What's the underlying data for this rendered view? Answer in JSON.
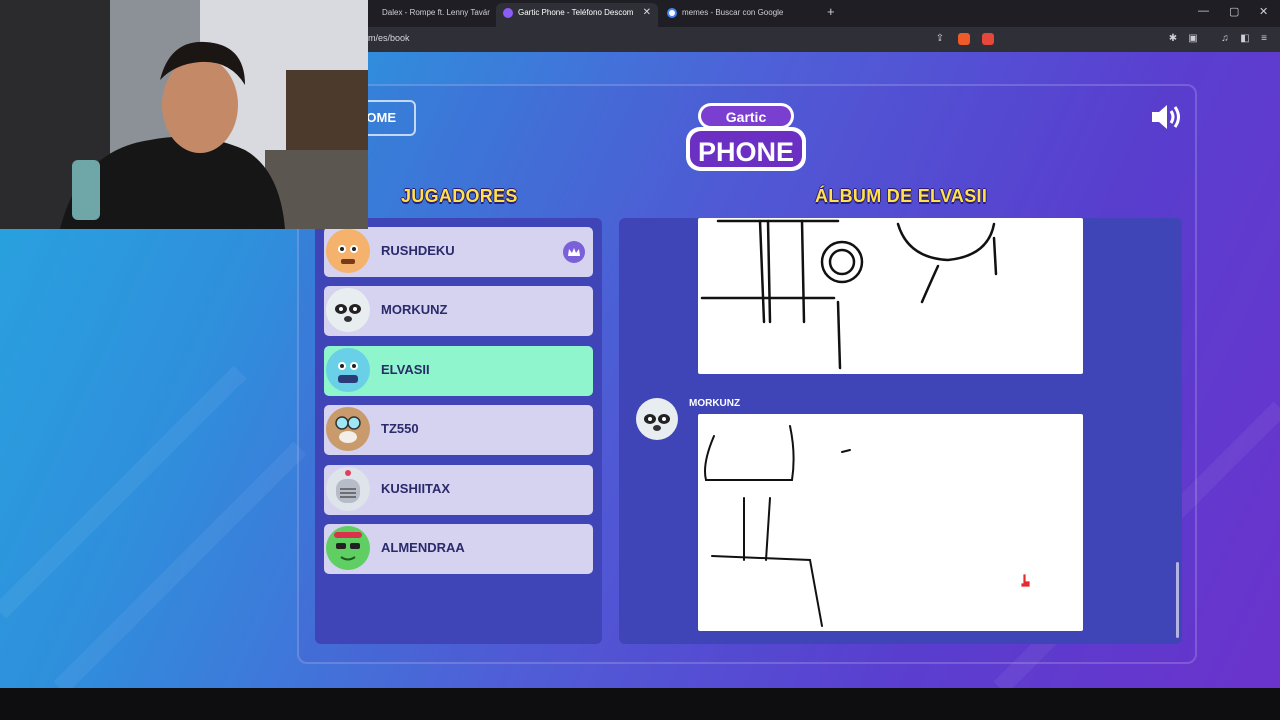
{
  "browser": {
    "tabs": [
      {
        "label": "Dalex - Rompe ft. Lenny Tavárez",
        "active": false
      },
      {
        "label": "Gartic Phone - Teléfono Descom",
        "active": true
      },
      {
        "label": "memes - Buscar con Google",
        "active": false
      }
    ],
    "url": "m/es/book",
    "window_controls": [
      "—",
      "▢",
      "✕"
    ]
  },
  "game": {
    "home_label": "OME",
    "logo_line1": "Gartic",
    "logo_line2": "PHONE",
    "players_heading": "JUGADORES",
    "album_heading": "ÁLBUM DE ELVASII",
    "players": [
      {
        "name": "RUSHDEKU",
        "host": true,
        "selected": false,
        "avatar_color": "#f4b26d"
      },
      {
        "name": "MORKUNZ",
        "host": false,
        "selected": false,
        "avatar_color": "#e8eef0"
      },
      {
        "name": "ELVASII",
        "host": false,
        "selected": true,
        "avatar_color": "#6ad0e8"
      },
      {
        "name": "TZ550",
        "host": false,
        "selected": false,
        "avatar_color": "#c99a6b"
      },
      {
        "name": "KUSHIITAX",
        "host": false,
        "selected": false,
        "avatar_color": "#dfe3ea"
      },
      {
        "name": "ALMENDRAA",
        "host": false,
        "selected": false,
        "avatar_color": "#5fcf63"
      }
    ],
    "album_entries": [
      {
        "author": "MORKUNZ"
      }
    ]
  },
  "colors": {
    "heading": "#ffe14a",
    "panel": "#3f45b6",
    "selected": "#8ff5cc"
  }
}
